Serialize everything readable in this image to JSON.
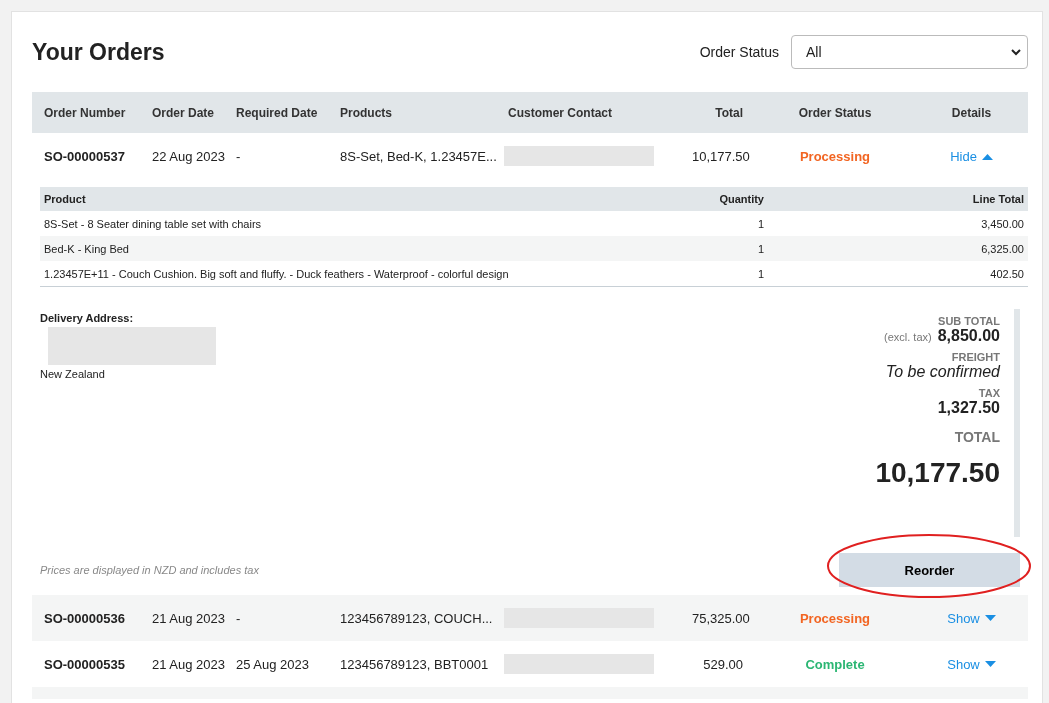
{
  "page": {
    "title": "Your Orders"
  },
  "filter": {
    "label": "Order Status",
    "value": "All"
  },
  "table": {
    "columns": [
      "Order Number",
      "Order Date",
      "Required Date",
      "Products",
      "Customer Contact",
      "Total",
      "Order Status",
      "Details"
    ],
    "orders": [
      {
        "number": "SO-00000537",
        "order_date": "22 Aug 2023",
        "required_date": "-",
        "products": "8S-Set, Bed-K, 1.23457E...",
        "total": "10,177.50",
        "status": {
          "label": "Processing",
          "color": "#f26522"
        },
        "toggle": "Hide",
        "expanded": true,
        "detail": {
          "columns": [
            "Product",
            "Quantity",
            "Line Total"
          ],
          "lines": [
            {
              "product": "8S-Set - 8 Seater dining table set with chairs",
              "quantity": "1",
              "line_total": "3,450.00"
            },
            {
              "product": "Bed-K - King Bed",
              "quantity": "1",
              "line_total": "6,325.00"
            },
            {
              "product": "1.23457E+11 - Couch Cushion. Big soft and fluffy. - Duck feathers - Waterproof - colorful design",
              "quantity": "1",
              "line_total": "402.50"
            }
          ],
          "address_label": "Delivery Address:",
          "address_country": "New Zealand",
          "totals": [
            {
              "kind": "amount",
              "label": "SUB TOTAL",
              "prefix": "(excl. tax)",
              "value": "8,850.00"
            },
            {
              "kind": "note",
              "label": "FREIGHT",
              "value": "To be confirmed"
            },
            {
              "kind": "amount",
              "label": "TAX",
              "value": "1,327.50"
            },
            {
              "kind": "grand",
              "label": "TOTAL",
              "value": "10,177.50"
            }
          ],
          "note": "Prices are displayed in NZD and includes tax",
          "reorder": {
            "label": "Reorder",
            "circled": true
          }
        }
      },
      {
        "number": "SO-00000536",
        "order_date": "21 Aug 2023",
        "required_date": "-",
        "products": "123456789123, COUCH...",
        "total": "75,325.00",
        "status": {
          "label": "Processing",
          "color": "#f26522"
        },
        "toggle": "Show",
        "expanded": false
      },
      {
        "number": "SO-00000535",
        "order_date": "21 Aug 2023",
        "required_date": "25 Aug 2023",
        "products": "123456789123, BBT0001",
        "total": "529.00",
        "status": {
          "label": "Complete",
          "color": "#2bb673"
        },
        "toggle": "Show",
        "expanded": false
      }
    ]
  }
}
